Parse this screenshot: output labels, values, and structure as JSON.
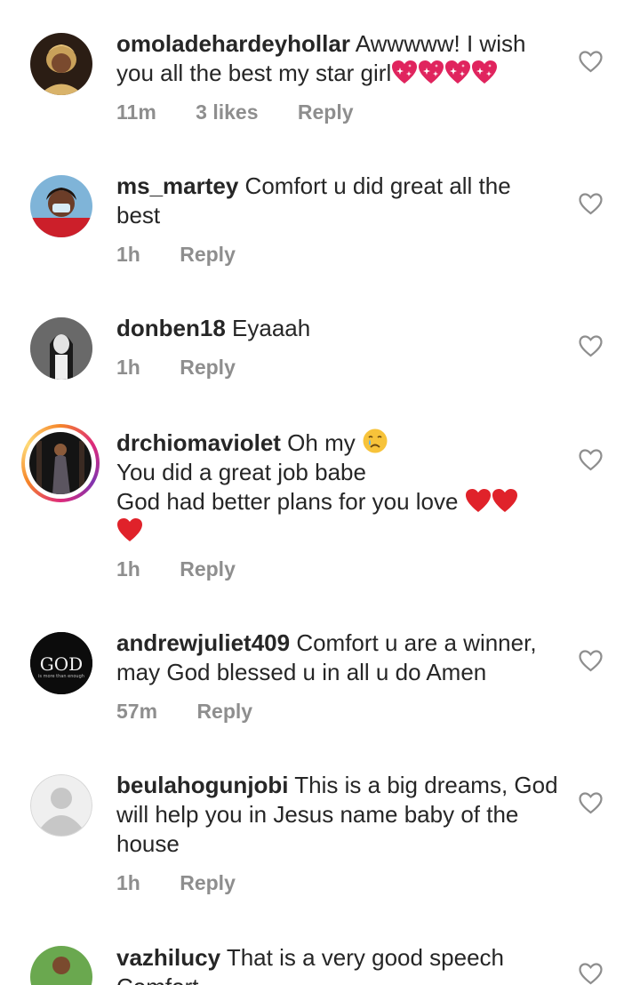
{
  "comments": [
    {
      "username": "omoladehardeyhollar",
      "text": "Awwwww! I wish you all the best my star girl",
      "emoji": "sparkling-heart x4",
      "time": "11m",
      "likes": "3 likes",
      "reply": "Reply"
    },
    {
      "username": "ms_martey",
      "text": "Comfort u did great all the best",
      "time": "1h",
      "reply": "Reply"
    },
    {
      "username": "donben18",
      "text": "Eyaaah",
      "time": "1h",
      "reply": "Reply"
    },
    {
      "username": "drchiomaviolet",
      "text": "Oh my",
      "emoji": "crying-face",
      "line2": "You did a great job babe",
      "line3": "God had better plans for you love",
      "emoji2": "red-heart x3",
      "time": "1h",
      "reply": "Reply",
      "has_story_ring": true
    },
    {
      "username": "andrewjuliet409",
      "text": "Comfort u are a winner, may God blessed u in all u do Amen",
      "avatar_text": "GOD",
      "avatar_subtext": "is more than enough",
      "time": "57m",
      "reply": "Reply"
    },
    {
      "username": "beulahogunjobi",
      "text": "This is a big dreams, God will help you in Jesus name baby of the house",
      "time": "1h",
      "reply": "Reply"
    },
    {
      "username": "vazhilucy",
      "text": "That is a very good speech",
      "line2": "Comfort"
    }
  ],
  "icons": {
    "like": "heart-outline-icon",
    "heart_color": "#e0245e"
  }
}
